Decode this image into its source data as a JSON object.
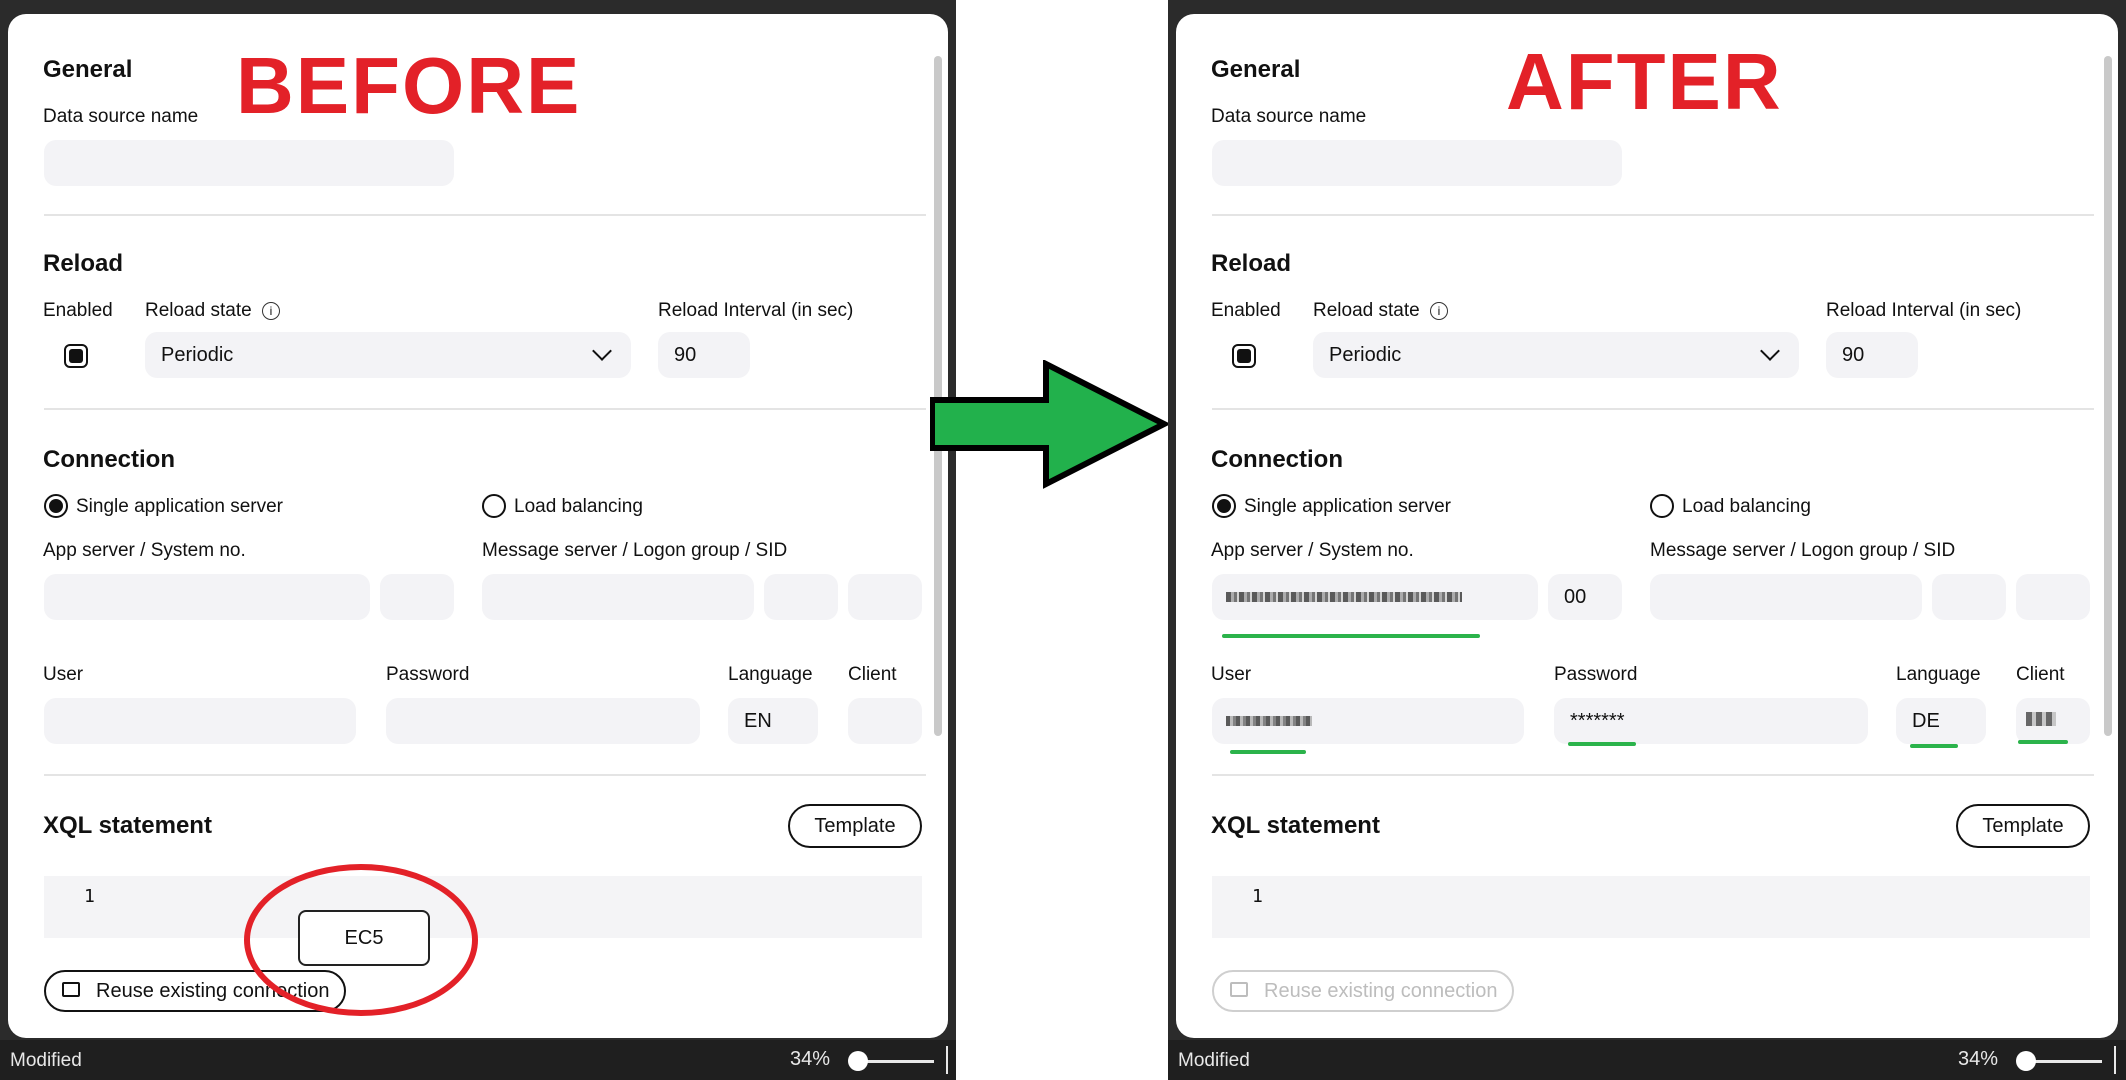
{
  "labels": {
    "before": "BEFORE",
    "after": "AFTER"
  },
  "colors": {
    "headline": "#e32128",
    "arrow_fill": "#22b14c",
    "highlight": "#2bb34b"
  },
  "form": {
    "general_title": "General",
    "data_source_label": "Data source name",
    "reload_title": "Reload",
    "enabled_label": "Enabled",
    "reload_state_label": "Reload state",
    "reload_state_value": "Periodic",
    "reload_interval_label": "Reload Interval (in sec)",
    "reload_interval_value": "90",
    "connection_title": "Connection",
    "single_server_label": "Single application server",
    "load_balancing_label": "Load balancing",
    "app_server_label": "App server / System no.",
    "message_server_label": "Message server / Logon group / SID",
    "user_label": "User",
    "password_label": "Password",
    "language_label": "Language",
    "client_label": "Client",
    "xql_title": "XQL statement",
    "template_button": "Template",
    "line_number": "1",
    "reuse_button": "Reuse existing connection"
  },
  "before": {
    "language_value": "EN",
    "popup_text": "EC5"
  },
  "after": {
    "system_no_value": "00",
    "password_value": "*******",
    "language_value": "DE"
  },
  "status": {
    "text": "Modified",
    "zoom": "34%"
  }
}
